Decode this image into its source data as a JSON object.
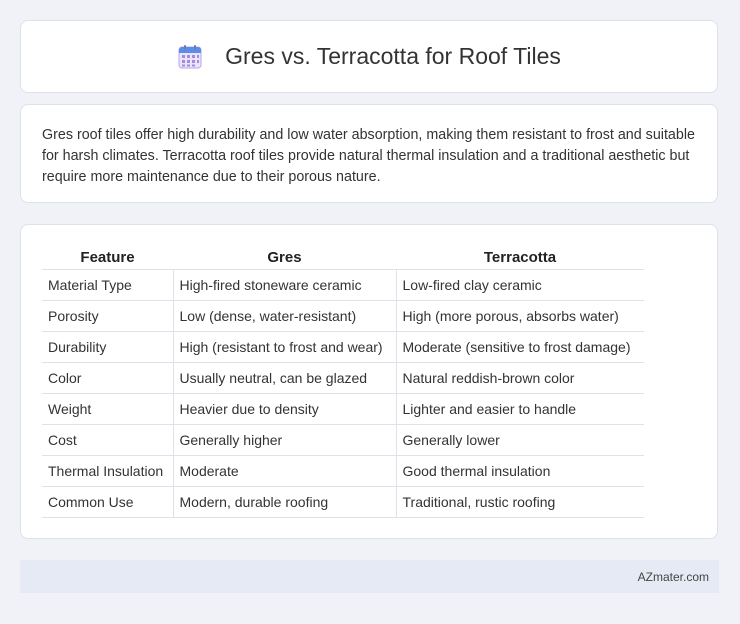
{
  "header": {
    "title": "Gres vs. Terracotta for Roof Tiles",
    "icon": "calendar-icon"
  },
  "summary": {
    "text": "Gres roof tiles offer high durability and low water absorption, making them resistant to frost and suitable for harsh climates. Terracotta roof tiles provide natural thermal insulation and a traditional aesthetic but require more maintenance due to their porous nature."
  },
  "table": {
    "headers": [
      "Feature",
      "Gres",
      "Terracotta"
    ],
    "rows": [
      [
        "Material Type",
        "High-fired stoneware ceramic",
        "Low-fired clay ceramic"
      ],
      [
        "Porosity",
        "Low (dense, water-resistant)",
        "High (more porous, absorbs water)"
      ],
      [
        "Durability",
        "High (resistant to frost and wear)",
        "Moderate (sensitive to frost damage)"
      ],
      [
        "Color",
        "Usually neutral, can be glazed",
        "Natural reddish-brown color"
      ],
      [
        "Weight",
        "Heavier due to density",
        "Lighter and easier to handle"
      ],
      [
        "Cost",
        "Generally higher",
        "Generally lower"
      ],
      [
        "Thermal Insulation",
        "Moderate",
        "Good thermal insulation"
      ],
      [
        "Common Use",
        "Modern, durable roofing",
        "Traditional, rustic roofing"
      ]
    ]
  },
  "footer": {
    "text": "AZmater.com"
  }
}
